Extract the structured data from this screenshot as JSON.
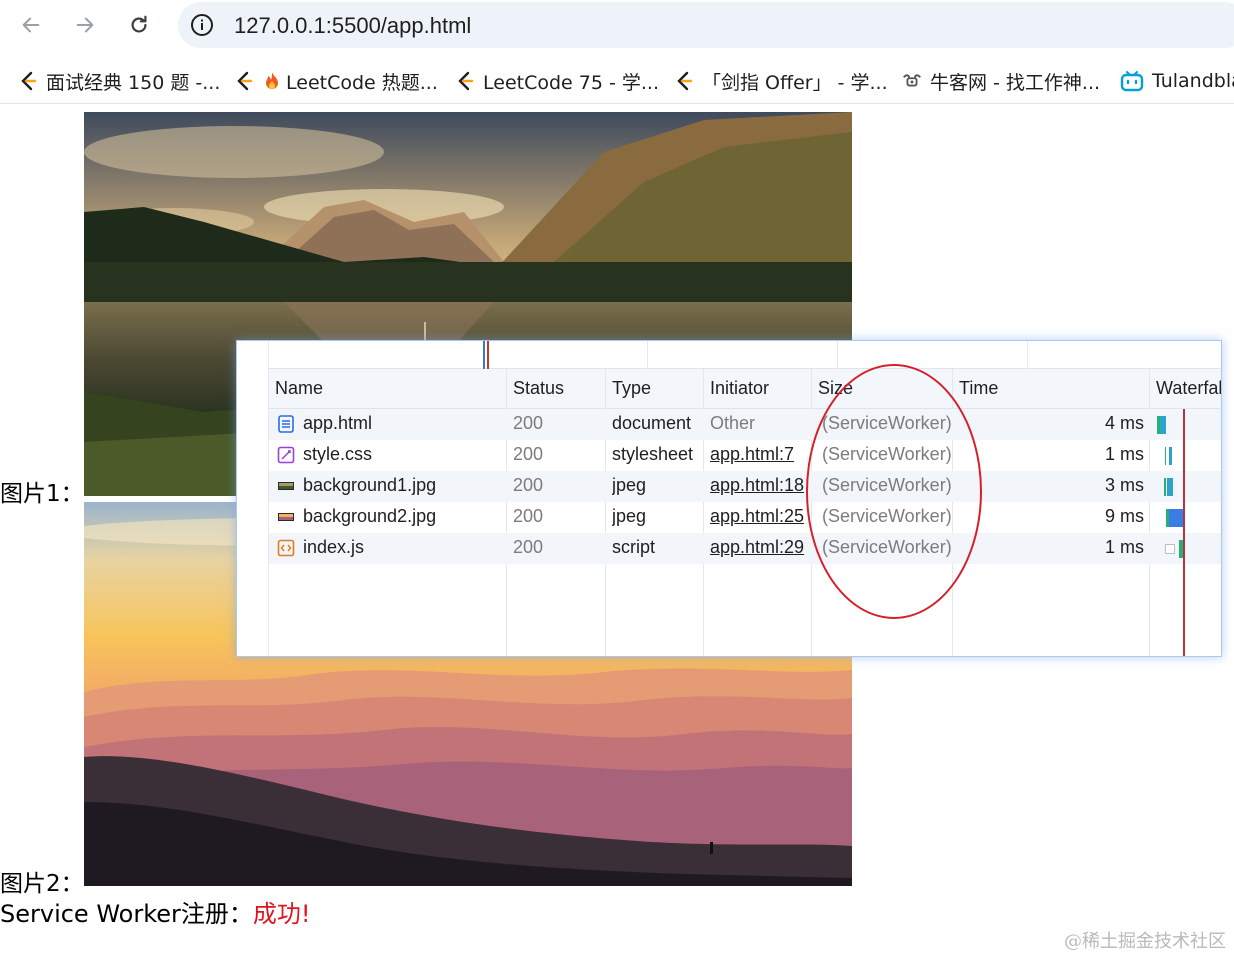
{
  "browser": {
    "url": "127.0.0.1:5500/app.html",
    "nav_icons": [
      "back-arrow-icon",
      "forward-arrow-icon",
      "reload-icon",
      "info-icon"
    ]
  },
  "bookmarks": [
    {
      "label": "面试经典 150 题 -...",
      "icon": "leetcode-icon"
    },
    {
      "label": "LeetCode 热题...",
      "icon": "leetcode-icon"
    },
    {
      "label": "LeetCode 75 - 学...",
      "icon": "leetcode-icon"
    },
    {
      "label": "「剑指 Offer」 - 学...",
      "icon": "leetcode-icon"
    },
    {
      "label": "牛客网 - 找工作神...",
      "icon": "nowcoder-icon"
    },
    {
      "label": "Tulandbla",
      "icon": "bilibili-icon"
    }
  ],
  "page": {
    "caption1": "图片1：",
    "caption2": "图片2：",
    "sw_label": "Service Worker注册：",
    "sw_status": "成功!",
    "status_color": "#e0141e"
  },
  "network": {
    "columns": [
      "Name",
      "Status",
      "Type",
      "Initiator",
      "Size",
      "Time",
      "Waterfall"
    ],
    "rows": [
      {
        "name": "app.html",
        "icon": "document-icon",
        "status": "200",
        "type": "document",
        "initiator": "Other",
        "initiator_link": false,
        "size": "(ServiceWorker)",
        "time": "4 ms",
        "waterfall_level": 0.6
      },
      {
        "name": "style.css",
        "icon": "stylesheet-icon",
        "status": "200",
        "type": "stylesheet",
        "initiator": "app.html:7",
        "initiator_link": true,
        "size": "(ServiceWorker)",
        "time": "1 ms",
        "waterfall_level": 0.2
      },
      {
        "name": "background1.jpg",
        "icon": "image-icon",
        "status": "200",
        "type": "jpeg",
        "initiator": "app.html:18",
        "initiator_link": true,
        "size": "(ServiceWorker)",
        "time": "3 ms",
        "waterfall_level": 0.5
      },
      {
        "name": "background2.jpg",
        "icon": "image-icon",
        "status": "200",
        "type": "jpeg",
        "initiator": "app.html:25",
        "initiator_link": true,
        "size": "(ServiceWorker)",
        "time": "9 ms",
        "waterfall_level": 1.0
      },
      {
        "name": "index.js",
        "icon": "script-icon",
        "status": "200",
        "type": "script",
        "initiator": "app.html:29",
        "initiator_link": true,
        "size": "(ServiceWorker)",
        "time": "1 ms",
        "waterfall_level": 0.2
      }
    ],
    "highlight_color": "#d5202a"
  },
  "watermark": "@稀土掘金技术社区"
}
